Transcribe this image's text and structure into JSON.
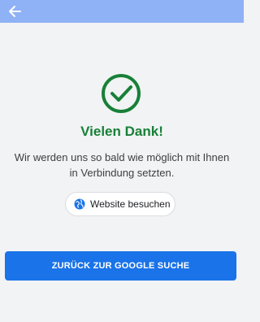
{
  "header": {
    "back_icon": "arrow-left-icon"
  },
  "confirmation": {
    "icon": "check-circle-icon",
    "title": "Vielen Dank!",
    "message_line1": "Wir werden uns so bald wie möglich mit Ihnen",
    "message_line2": "in Verbindung setzten."
  },
  "website_button": {
    "icon": "globe-icon",
    "label": "Website besuchen"
  },
  "google_button": {
    "label": "ZURÜCK ZUR GOOGLE SUCHE"
  },
  "colors": {
    "topbar": "#8fb1f5",
    "success_green": "#188038",
    "primary_blue": "#1a73e8",
    "background": "#f1f3f4"
  }
}
